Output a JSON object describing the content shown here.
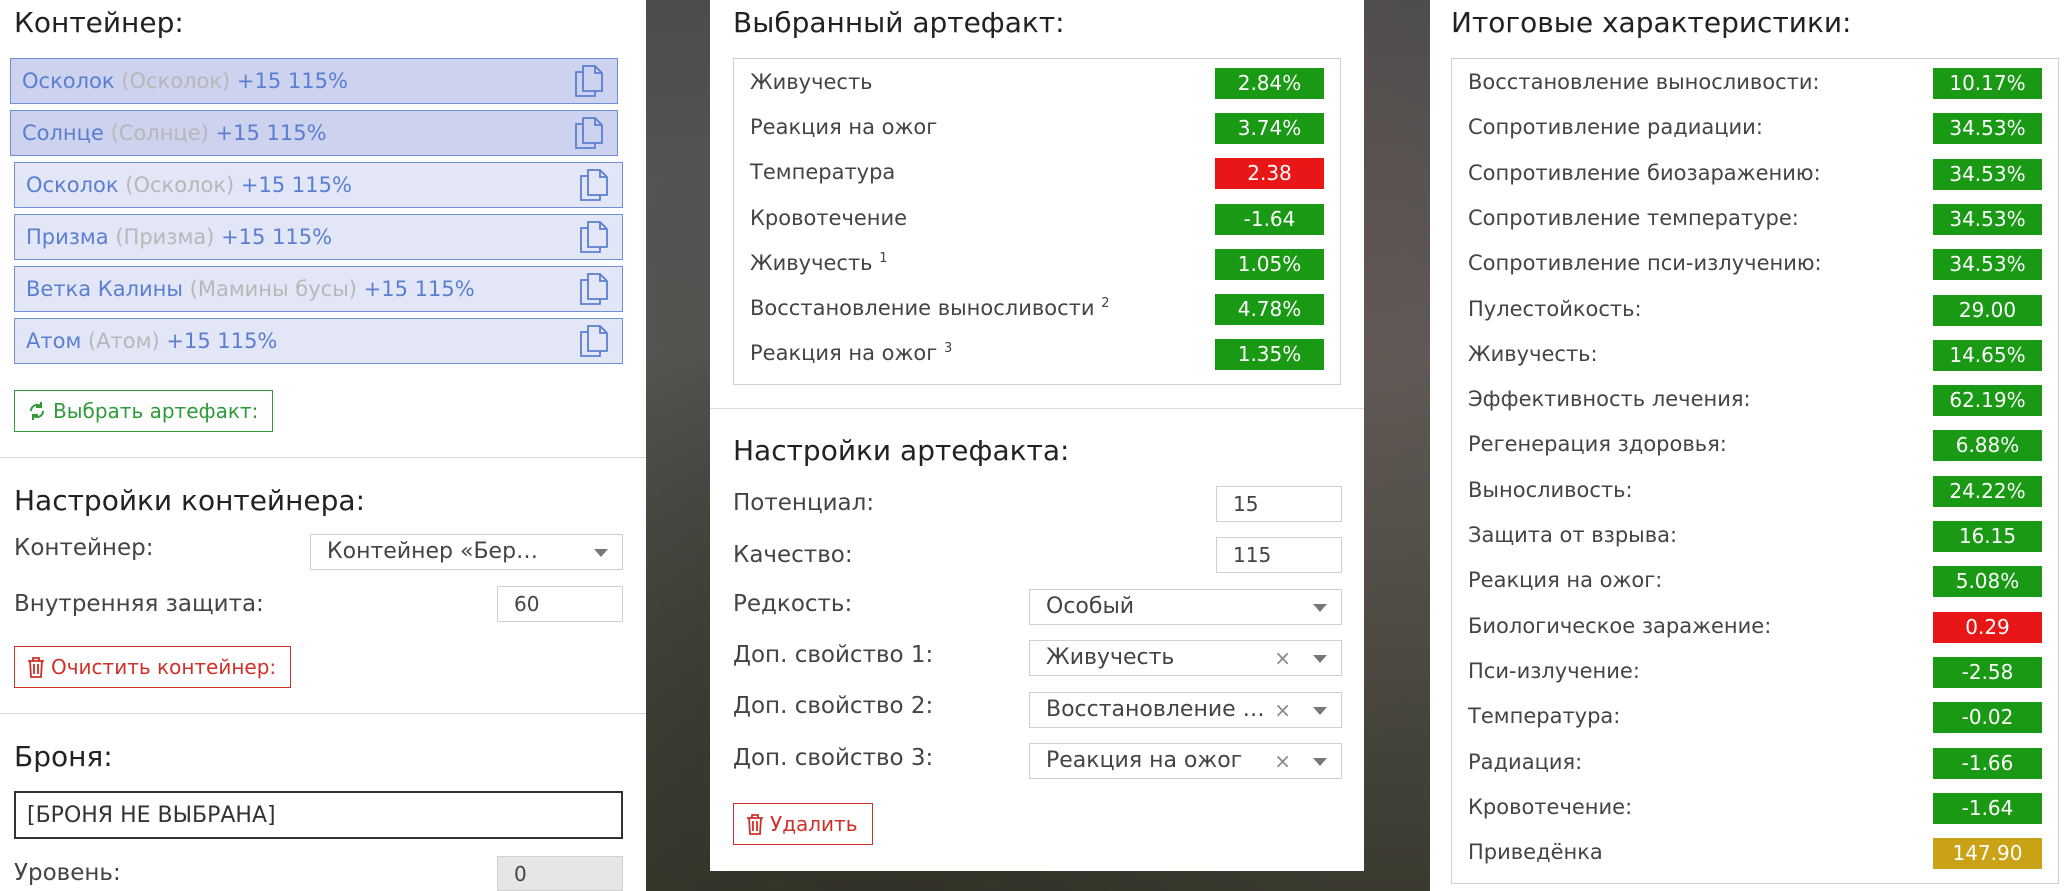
{
  "container": {
    "title": "Контейнер:",
    "slots": [
      {
        "name": "Осколок",
        "alt": "(Осколок)",
        "level": "+15 115%",
        "selected": true
      },
      {
        "name": "Солнце",
        "alt": "(Солнце)",
        "level": "+15 115%",
        "selected": true
      },
      {
        "name": "Осколок",
        "alt": "(Осколок)",
        "level": "+15 115%",
        "selected": false
      },
      {
        "name": "Призма",
        "alt": "(Призма)",
        "level": "+15 115%",
        "selected": false
      },
      {
        "name": "Ветка Калины",
        "alt": "(Мамины бусы)",
        "level": "+15 115%",
        "selected": false
      },
      {
        "name": "Атом",
        "alt": "(Атом)",
        "level": "+15 115%",
        "selected": false
      }
    ],
    "pick_button": "Выбрать артефакт:"
  },
  "container_settings": {
    "title": "Настройки контейнера:",
    "container_label": "Контейнер:",
    "container_value": "Контейнер «Берлога…",
    "protection_label": "Внутренняя защита:",
    "protection_value": "60",
    "clear_button": "Очистить контейнер:"
  },
  "armor": {
    "title": "Броня:",
    "value": "[БРОНЯ НЕ ВЫБРАНА]",
    "level_label": "Уровень:",
    "level_value": "0"
  },
  "selected_artifact": {
    "title": "Выбранный артефакт:",
    "stats": [
      {
        "name": "Живучесть",
        "sup": "",
        "value": "2.84%",
        "color": "green"
      },
      {
        "name": "Реакция на ожог",
        "sup": "",
        "value": "3.74%",
        "color": "green"
      },
      {
        "name": "Температура",
        "sup": "",
        "value": "2.38",
        "color": "red"
      },
      {
        "name": "Кровотечение",
        "sup": "",
        "value": "-1.64",
        "color": "green"
      },
      {
        "name": "Живучесть",
        "sup": "1",
        "value": "1.05%",
        "color": "green"
      },
      {
        "name": "Восстановление выносливости",
        "sup": "2",
        "value": "4.78%",
        "color": "green"
      },
      {
        "name": "Реакция на ожог",
        "sup": "3",
        "value": "1.35%",
        "color": "green"
      }
    ]
  },
  "artifact_settings": {
    "title": "Настройки артефакта:",
    "potential_label": "Потенциал:",
    "potential_value": "15",
    "quality_label": "Качество:",
    "quality_value": "115",
    "rarity_label": "Редкость:",
    "rarity_value": "Особый",
    "prop1_label": "Доп. свойство 1:",
    "prop1_value": "Живучесть",
    "prop2_label": "Доп. свойство 2:",
    "prop2_value": "Восстановление в...",
    "prop3_label": "Доп. свойство 3:",
    "prop3_value": "Реакция на ожог",
    "clear_symbol": "×",
    "delete_button": "Удалить"
  },
  "totals": {
    "title": "Итоговые характеристики:",
    "stats": [
      {
        "name": "Восстановление выносливости:",
        "value": "10.17%",
        "color": "green"
      },
      {
        "name": "Сопротивление радиации:",
        "value": "34.53%",
        "color": "green"
      },
      {
        "name": "Сопротивление биозаражению:",
        "value": "34.53%",
        "color": "green"
      },
      {
        "name": "Сопротивление температуре:",
        "value": "34.53%",
        "color": "green"
      },
      {
        "name": "Сопротивление пси-излучению:",
        "value": "34.53%",
        "color": "green"
      },
      {
        "name": "Пулестойкость:",
        "value": "29.00",
        "color": "green"
      },
      {
        "name": "Живучесть:",
        "value": "14.65%",
        "color": "green"
      },
      {
        "name": "Эффективность лечения:",
        "value": "62.19%",
        "color": "green"
      },
      {
        "name": "Регенерация здоровья:",
        "value": "6.88%",
        "color": "green"
      },
      {
        "name": "Выносливость:",
        "value": "24.22%",
        "color": "green"
      },
      {
        "name": "Защита от взрыва:",
        "value": "16.15",
        "color": "green"
      },
      {
        "name": "Реакция на ожог:",
        "value": "5.08%",
        "color": "green"
      },
      {
        "name": "Биологическое заражение:",
        "value": "0.29",
        "color": "red"
      },
      {
        "name": "Пси-излучение:",
        "value": "-2.58",
        "color": "green"
      },
      {
        "name": "Температура:",
        "value": "-0.02",
        "color": "green"
      },
      {
        "name": "Радиация:",
        "value": "-1.66",
        "color": "green"
      },
      {
        "name": "Кровотечение:",
        "value": "-1.64",
        "color": "green"
      },
      {
        "name": "Приведёнка",
        "value": "147.90",
        "color": "yellow"
      }
    ]
  },
  "colors": {
    "green": "#1a9a14",
    "red": "#e81616",
    "yellow": "#c9a216",
    "slot_border": "#6f8fd6"
  },
  "icons": [
    "copy-icon",
    "refresh-icon",
    "trash-icon",
    "chevron-down-icon",
    "clear-icon"
  ]
}
